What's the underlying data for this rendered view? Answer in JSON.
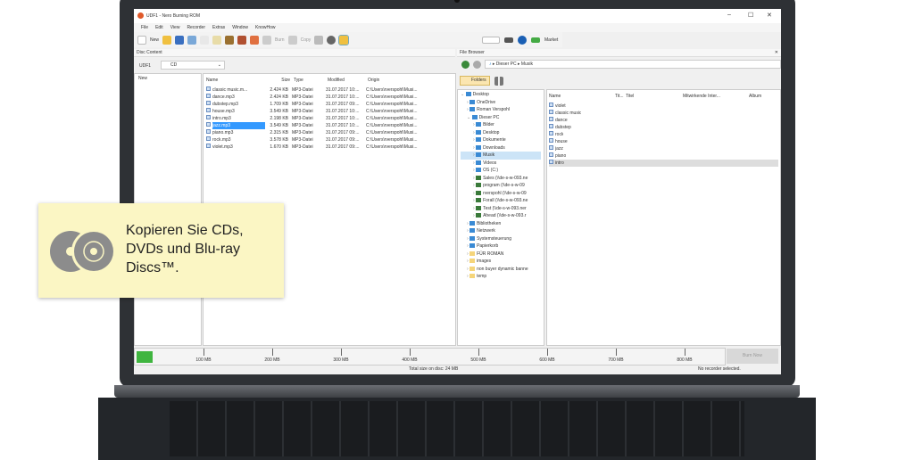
{
  "window": {
    "title": "UDF1 - Nero Burning ROM",
    "controls": [
      "–",
      "☐",
      "✕"
    ]
  },
  "menu": [
    "File",
    "Edit",
    "View",
    "Recorder",
    "Extras",
    "Window",
    "KnowHow"
  ],
  "toolbar": {
    "new": "New",
    "burn": "Burn",
    "copy": "Copy",
    "market": "Market"
  },
  "disc_content": {
    "header": "Disc Content",
    "label": "UDF1",
    "disc_type": "CD",
    "tree_root": "New",
    "columns": [
      "Name",
      "Size",
      "Type",
      "Modified",
      "Origin"
    ],
    "files": [
      [
        "classic music.m...",
        "2.424 KB",
        "MP3-Datei",
        "31.07.2017 10:...",
        "C:\\Users\\rverspohl\\Musi..."
      ],
      [
        "dance.mp3",
        "2.424 KB",
        "MP3-Datei",
        "31.07.2017 10:...",
        "C:\\Users\\rverspohl\\Musi..."
      ],
      [
        "dubstep.mp3",
        "1.709 KB",
        "MP3-Datei",
        "31.07.2017 09:...",
        "C:\\Users\\rverspohl\\Musi..."
      ],
      [
        "house.mp3",
        "3.549 KB",
        "MP3-Datei",
        "31.07.2017 10:...",
        "C:\\Users\\rverspohl\\Musi..."
      ],
      [
        "intro.mp3",
        "2.198 KB",
        "MP3-Datei",
        "31.07.2017 10:...",
        "C:\\Users\\rverspohl\\Musi..."
      ],
      [
        "jazz.mp3",
        "3.549 KB",
        "MP3-Datei",
        "31.07.2017 10:...",
        "C:\\Users\\rverspohl\\Musi..."
      ],
      [
        "piano.mp3",
        "2.315 KB",
        "MP3-Datei",
        "31.07.2017 09:...",
        "C:\\Users\\rverspohl\\Musi..."
      ],
      [
        "rock.mp3",
        "3.578 KB",
        "MP3-Datei",
        "31.07.2017 09:...",
        "C:\\Users\\rverspohl\\Musi..."
      ],
      [
        "violet.mp3",
        "1.670 KB",
        "MP3-Datei",
        "31.07.2017 09:...",
        "C:\\Users\\rverspohl\\Musi..."
      ]
    ],
    "selected_index": 5
  },
  "file_browser": {
    "header": "File Browser",
    "breadcrumb": [
      "Dieser PC",
      "Musik"
    ],
    "folders_button": "Folders",
    "tree": [
      {
        "label": "Desktop",
        "level": 0
      },
      {
        "label": "OneDrive",
        "level": 1
      },
      {
        "label": "Roman Verspohl",
        "level": 1
      },
      {
        "label": "Dieser PC",
        "level": 1
      },
      {
        "label": "Bilder",
        "level": 2
      },
      {
        "label": "Desktop",
        "level": 2
      },
      {
        "label": "Dokumente",
        "level": 2
      },
      {
        "label": "Downloads",
        "level": 2
      },
      {
        "label": "Musik",
        "level": 2
      },
      {
        "label": "Videos",
        "level": 2
      },
      {
        "label": "OS (C:)",
        "level": 2
      },
      {
        "label": "Sales (\\\\de-s-w-093.ne",
        "level": 2
      },
      {
        "label": "program (\\\\de-s-w-09",
        "level": 2
      },
      {
        "label": "rverspohl (\\\\de-s-w-09",
        "level": 2
      },
      {
        "label": "Forall (\\\\de-s-w-093.ne",
        "level": 2
      },
      {
        "label": "Test (\\\\de-s-w-093.ner",
        "level": 2
      },
      {
        "label": "Ahead (\\\\de-s-w-093.r",
        "level": 2
      },
      {
        "label": "Bibliotheken",
        "level": 1
      },
      {
        "label": "Netzwerk",
        "level": 1
      },
      {
        "label": "Systemsteuerung",
        "level": 1
      },
      {
        "label": "Papierkorb",
        "level": 1
      },
      {
        "label": "FÜR ROMAN",
        "level": 1
      },
      {
        "label": "images",
        "level": 1
      },
      {
        "label": "non buyer dynamic banne",
        "level": 1
      },
      {
        "label": "temp",
        "level": 1
      }
    ],
    "columns": [
      "Name",
      "Tit...",
      "Titel",
      "Mitwirkende Inter...",
      "Album"
    ],
    "files": [
      "violet",
      "classic music",
      "dance",
      "dubstep",
      "rock",
      "house",
      "jazz",
      "piano",
      "intro"
    ],
    "selected_index": 8
  },
  "capacity": {
    "ticks": [
      "100 MB",
      "200 MB",
      "300 MB",
      "400 MB",
      "500 MB",
      "600 MB",
      "700 MB",
      "800 MB"
    ],
    "used_mb": 24,
    "burn_button": "Burn Now",
    "total": "Total size on disc: 24 MB",
    "recorder": "No recorder selected."
  },
  "callout": {
    "text": "Kopieren Sie CDs, DVDs und Blu-ray Discs™."
  },
  "colors": {
    "callout_bg": "#fbf6c4",
    "progress": "#3fb53f",
    "selection": "#cce4f7"
  }
}
